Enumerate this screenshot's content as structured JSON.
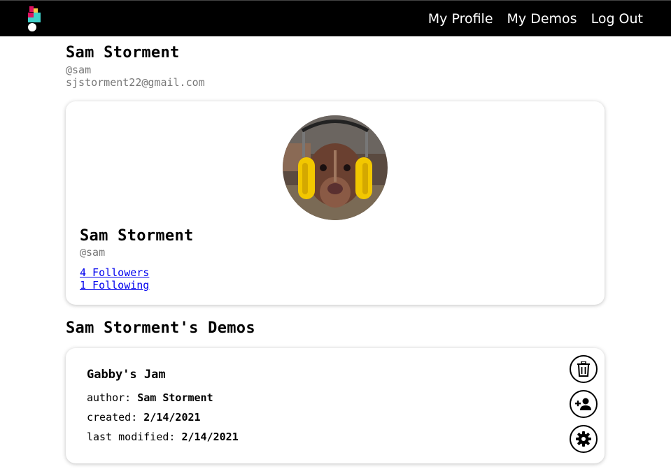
{
  "nav": {
    "logo": "app-logo",
    "links": [
      "My Profile",
      "My Demos",
      "Log Out"
    ]
  },
  "header": {
    "name": "Sam Storment",
    "handle": "@sam",
    "email": "sjstorment22@gmail.com"
  },
  "profile_card": {
    "avatar": "dog-with-earmuffs-photo",
    "name": "Sam Storment",
    "handle": "@sam",
    "followers": "4 Followers",
    "following": "1 Following"
  },
  "demos_section": {
    "title": "Sam Storment's Demos"
  },
  "demo": {
    "title": "Gabby's Jam",
    "author_label": "author:",
    "author": "Sam Storment",
    "created_label": "created:",
    "created": "2/14/2021",
    "modified_label": "last modified:",
    "modified": "2/14/2021",
    "actions": [
      "trash-icon",
      "add-person-icon",
      "gear-icon"
    ]
  },
  "colors": {
    "navbar": "#000000",
    "link": "#0000ee",
    "muted": "#777777"
  }
}
